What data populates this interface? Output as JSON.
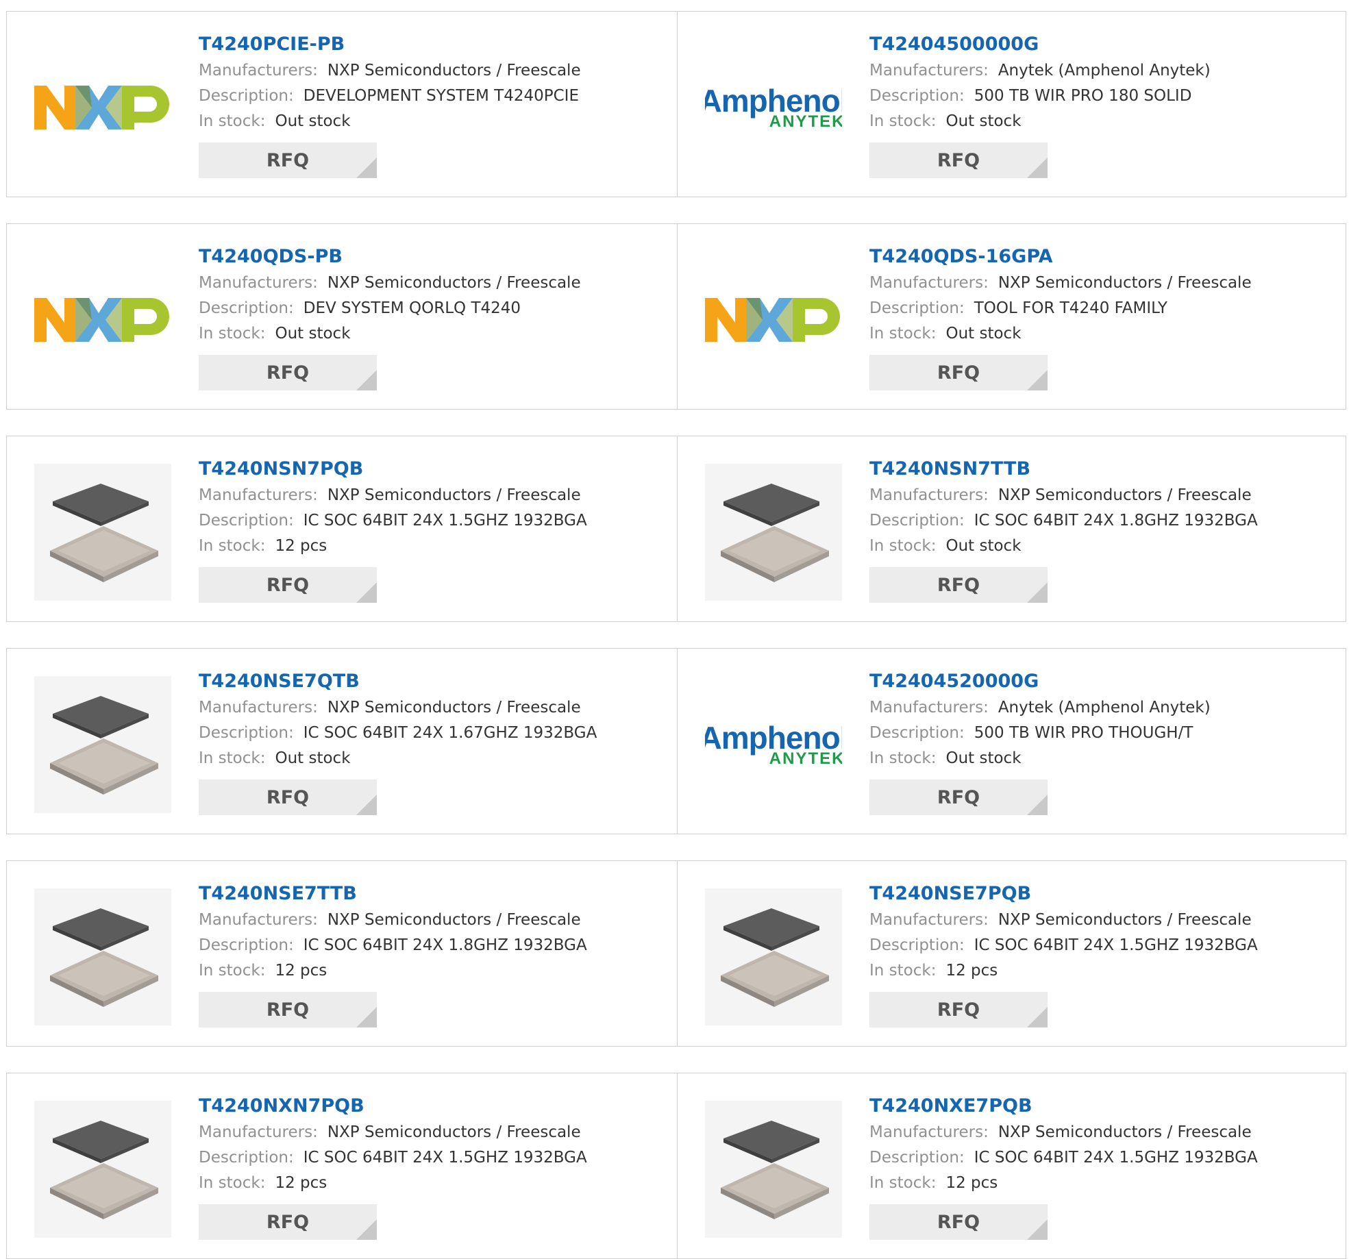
{
  "labels": {
    "manufacturers": "Manufacturers:",
    "description": "Description:",
    "in_stock": "In stock:",
    "rfq": "RFQ"
  },
  "colors": {
    "part_link": "#1565b0",
    "label_gray": "#909090",
    "value_dark": "#333333",
    "button_bg": "#ececec",
    "nxp_orange": "#f4a416",
    "nxp_blue": "#5ea7d9",
    "nxp_green": "#a6c52f",
    "amphenol_blue": "#1565b0",
    "anytek_green": "#1f9a4b"
  },
  "logos": {
    "amphenol_main": "Amphenol",
    "amphenol_sub": "ANYTEK"
  },
  "products": [
    {
      "part": "T4240PCIE-PB",
      "manufacturer": "NXP Semiconductors / Freescale",
      "description": "DEVELOPMENT SYSTEM T4240PCIE",
      "stock": "Out stock",
      "image": "nxp-logo"
    },
    {
      "part": "T42404500000G",
      "manufacturer": "Anytek (Amphenol Anytek)",
      "description": "500 TB WIR PRO 180 SOLID",
      "stock": "Out stock",
      "image": "amphenol-anytek-logo"
    },
    {
      "part": "T4240QDS-PB",
      "manufacturer": "NXP Semiconductors / Freescale",
      "description": "DEV SYSTEM QORLQ T4240",
      "stock": "Out stock",
      "image": "nxp-logo"
    },
    {
      "part": "T4240QDS-16GPA",
      "manufacturer": "NXP Semiconductors / Freescale",
      "description": "TOOL FOR T4240 FAMILY",
      "stock": "Out stock",
      "image": "nxp-logo"
    },
    {
      "part": "T4240NSN7PQB",
      "manufacturer": "NXP Semiconductors / Freescale",
      "description": "IC SOC 64BIT 24X 1.5GHZ 1932BGA",
      "stock": "12 pcs",
      "image": "chip-package"
    },
    {
      "part": "T4240NSN7TTB",
      "manufacturer": "NXP Semiconductors / Freescale",
      "description": "IC SOC 64BIT 24X 1.8GHZ 1932BGA",
      "stock": "Out stock",
      "image": "chip-package"
    },
    {
      "part": "T4240NSE7QTB",
      "manufacturer": "NXP Semiconductors / Freescale",
      "description": "IC SOC 64BIT 24X 1.67GHZ 1932BGA",
      "stock": "Out stock",
      "image": "chip-package"
    },
    {
      "part": "T42404520000G",
      "manufacturer": "Anytek (Amphenol Anytek)",
      "description": "500 TB WIR PRO THOUGH/T",
      "stock": "Out stock",
      "image": "amphenol-anytek-logo"
    },
    {
      "part": "T4240NSE7TTB",
      "manufacturer": "NXP Semiconductors / Freescale",
      "description": "IC SOC 64BIT 24X 1.8GHZ 1932BGA",
      "stock": "12 pcs",
      "image": "chip-package"
    },
    {
      "part": "T4240NSE7PQB",
      "manufacturer": "NXP Semiconductors / Freescale",
      "description": "IC SOC 64BIT 24X 1.5GHZ 1932BGA",
      "stock": "12 pcs",
      "image": "chip-package"
    },
    {
      "part": "T4240NXN7PQB",
      "manufacturer": "NXP Semiconductors / Freescale",
      "description": "IC SOC 64BIT 24X 1.5GHZ 1932BGA",
      "stock": "12 pcs",
      "image": "chip-package"
    },
    {
      "part": "T4240NXE7PQB",
      "manufacturer": "NXP Semiconductors / Freescale",
      "description": "IC SOC 64BIT 24X 1.5GHZ 1932BGA",
      "stock": "12 pcs",
      "image": "chip-package"
    }
  ]
}
